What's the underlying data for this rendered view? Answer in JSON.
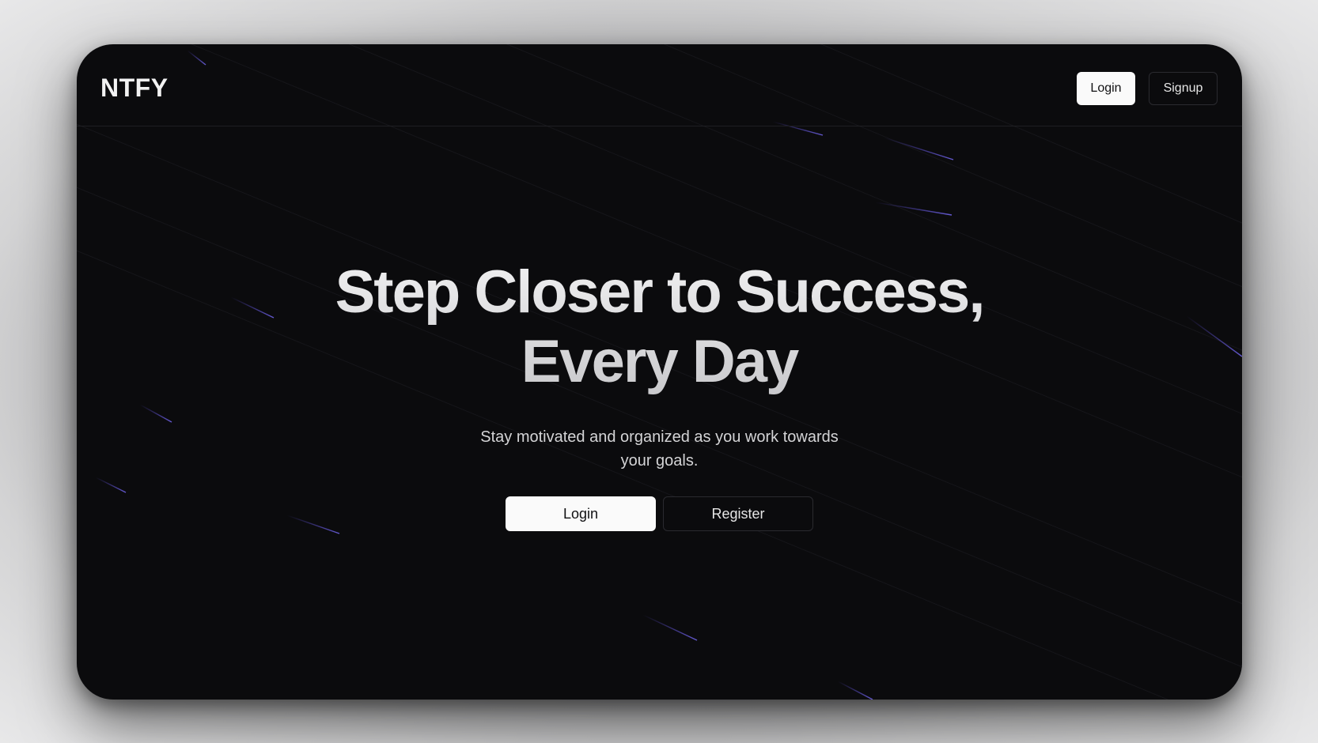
{
  "navbar": {
    "brand": "NTFY",
    "login_label": "Login",
    "signup_label": "Signup"
  },
  "hero": {
    "title_line1": "Step Closer to Success,",
    "title_line2": "Every Day",
    "subtitle": "Stay motivated and organized as you work towards your goals.",
    "login_label": "Login",
    "register_label": "Register"
  },
  "colors": {
    "background": "#0b0b0d",
    "primary_button": "#fafafa",
    "streak_accent": "#5b4bd6"
  }
}
